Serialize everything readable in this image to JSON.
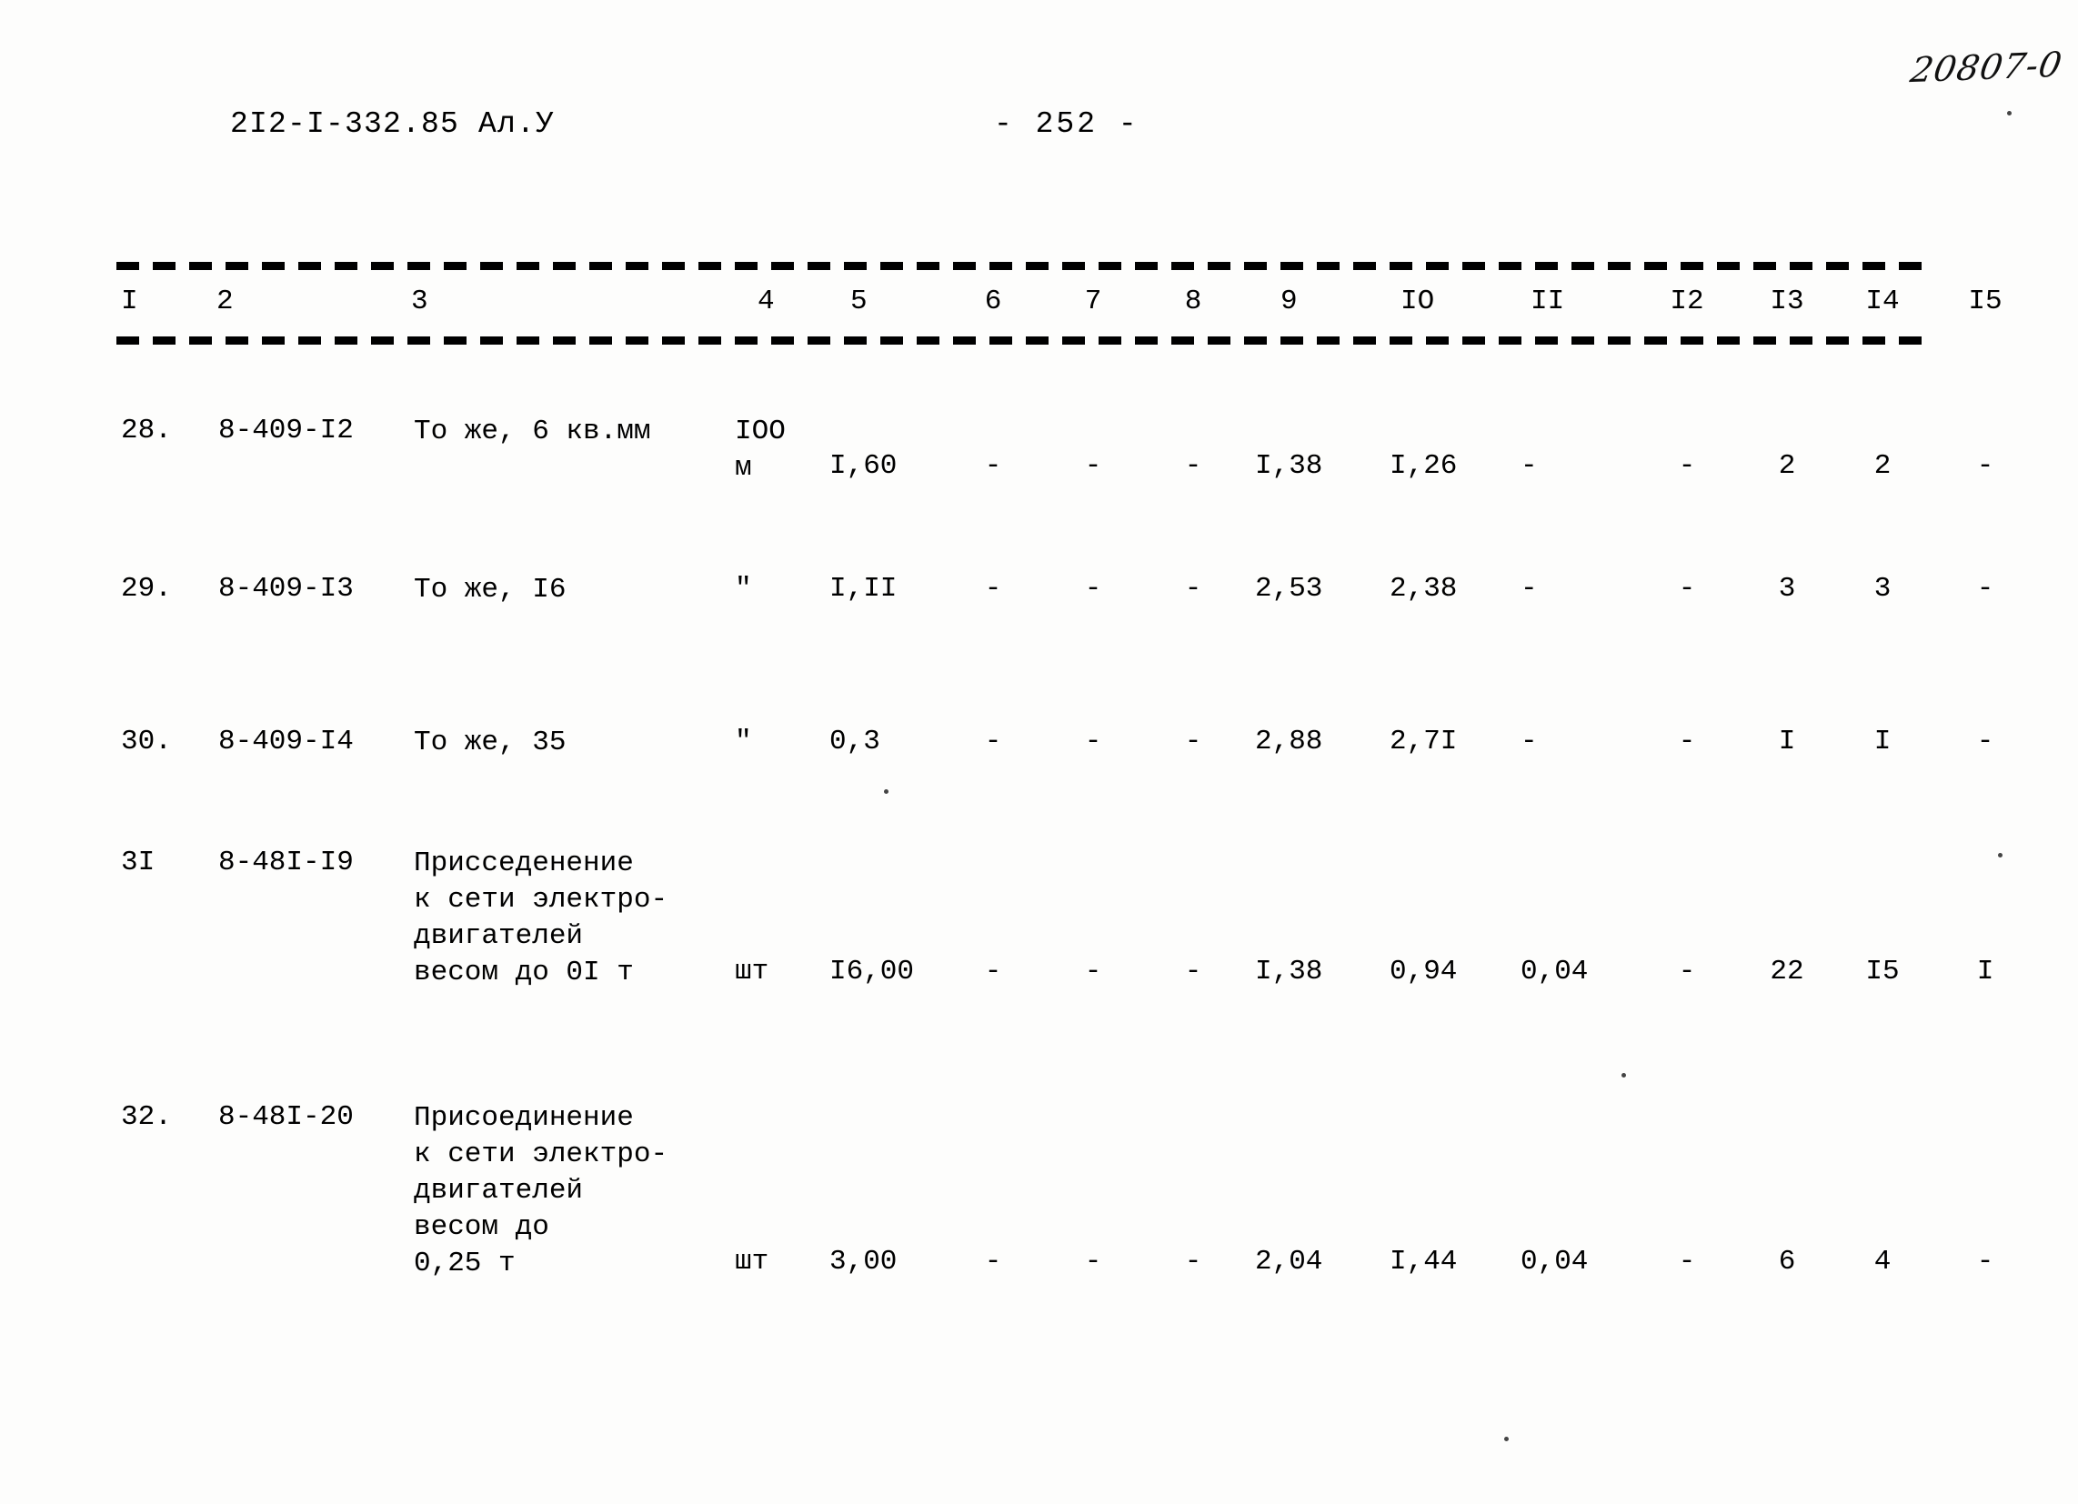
{
  "document": {
    "code": "2I2-I-332.85 Ал.У",
    "page_label": "-  252  -",
    "handwritten_note": "20807-0"
  },
  "table": {
    "column_headers": [
      "I",
      "2",
      "3",
      "4",
      "5",
      "6",
      "7",
      "8",
      "9",
      "IO",
      "II",
      "I2",
      "I3",
      "I4",
      "I5"
    ],
    "rows": [
      {
        "no": "28.",
        "code": "8-409-I2",
        "description": "То же, 6 кв.мм",
        "unit": "IOO\nм",
        "c5": "I,60",
        "c6": "-",
        "c7": "-",
        "c8": "-",
        "c9": "I,38",
        "c10": "I,26",
        "c11": "-",
        "c12": "-",
        "c13": "2",
        "c14": "2",
        "c15": "-"
      },
      {
        "no": "29.",
        "code": "8-409-I3",
        "description": "То же, I6",
        "unit": "\"",
        "c5": "I,II",
        "c6": "-",
        "c7": "-",
        "c8": "-",
        "c9": "2,53",
        "c10": "2,38",
        "c11": "-",
        "c12": "-",
        "c13": "3",
        "c14": "3",
        "c15": "-"
      },
      {
        "no": "30.",
        "code": "8-409-I4",
        "description": "То же, 35",
        "unit": "\"",
        "c5": "0,3",
        "c6": "-",
        "c7": "-",
        "c8": "-",
        "c9": "2,88",
        "c10": "2,7I",
        "c11": "-",
        "c12": "-",
        "c13": "I",
        "c14": "I",
        "c15": "-"
      },
      {
        "no": "3I",
        "code": "8-48I-I9",
        "description": "Присседенение\nк сети электро-\nдвигателей\nвесом до 0I т",
        "unit": "шт",
        "c5": "I6,00",
        "c6": "-",
        "c7": "-",
        "c8": "-",
        "c9": "I,38",
        "c10": "0,94",
        "c11": "0,04",
        "c12": "-",
        "c13": "22",
        "c14": "I5",
        "c15": "I"
      },
      {
        "no": "32.",
        "code": "8-48I-20",
        "description": "Присоединение\nк сети электро-\nдвигателей\nвесом до\n0,25 т",
        "unit": "шт",
        "c5": "3,00",
        "c6": "-",
        "c7": "-",
        "c8": "-",
        "c9": "2,04",
        "c10": "I,44",
        "c11": "0,04",
        "c12": "-",
        "c13": "6",
        "c14": "4",
        "c15": "-"
      }
    ]
  }
}
